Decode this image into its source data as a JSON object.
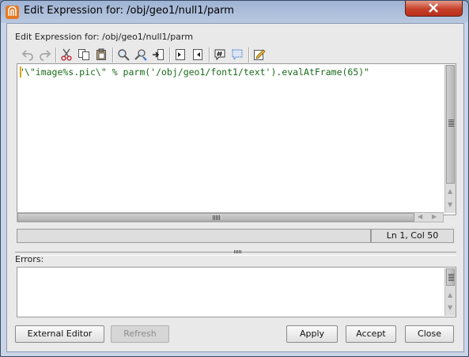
{
  "window": {
    "title": "Edit Expression for: /obj/geo1/null1/parm"
  },
  "prompt": "Edit Expression for: /obj/geo1/null1/parm",
  "toolbar": [
    {
      "name": "undo-icon"
    },
    {
      "name": "redo-icon"
    },
    {
      "name": "cut-icon"
    },
    {
      "name": "copy-icon"
    },
    {
      "name": "paste-icon"
    },
    {
      "name": "find-icon"
    },
    {
      "name": "find-replace-icon"
    },
    {
      "name": "goto-line-icon"
    },
    {
      "name": "indent-icon"
    },
    {
      "name": "unindent-icon"
    },
    {
      "name": "comment-icon"
    },
    {
      "name": "uncomment-icon"
    },
    {
      "name": "edit-icon"
    }
  ],
  "editor": {
    "code": "\"\\\"image%s.pic\\\" % parm('/obj/geo1/font1/text').evalAtFrame(65)\""
  },
  "status": {
    "position": "Ln 1, Col 50"
  },
  "errors": {
    "label": "Errors:",
    "text": ""
  },
  "buttons": {
    "external_editor": "External Editor",
    "refresh": "Refresh",
    "apply": "Apply",
    "accept": "Accept",
    "close": "Close"
  },
  "colors": {
    "code_text": "#1a6b1a",
    "caret": "#d9a400",
    "title_close": "#c7402a"
  }
}
